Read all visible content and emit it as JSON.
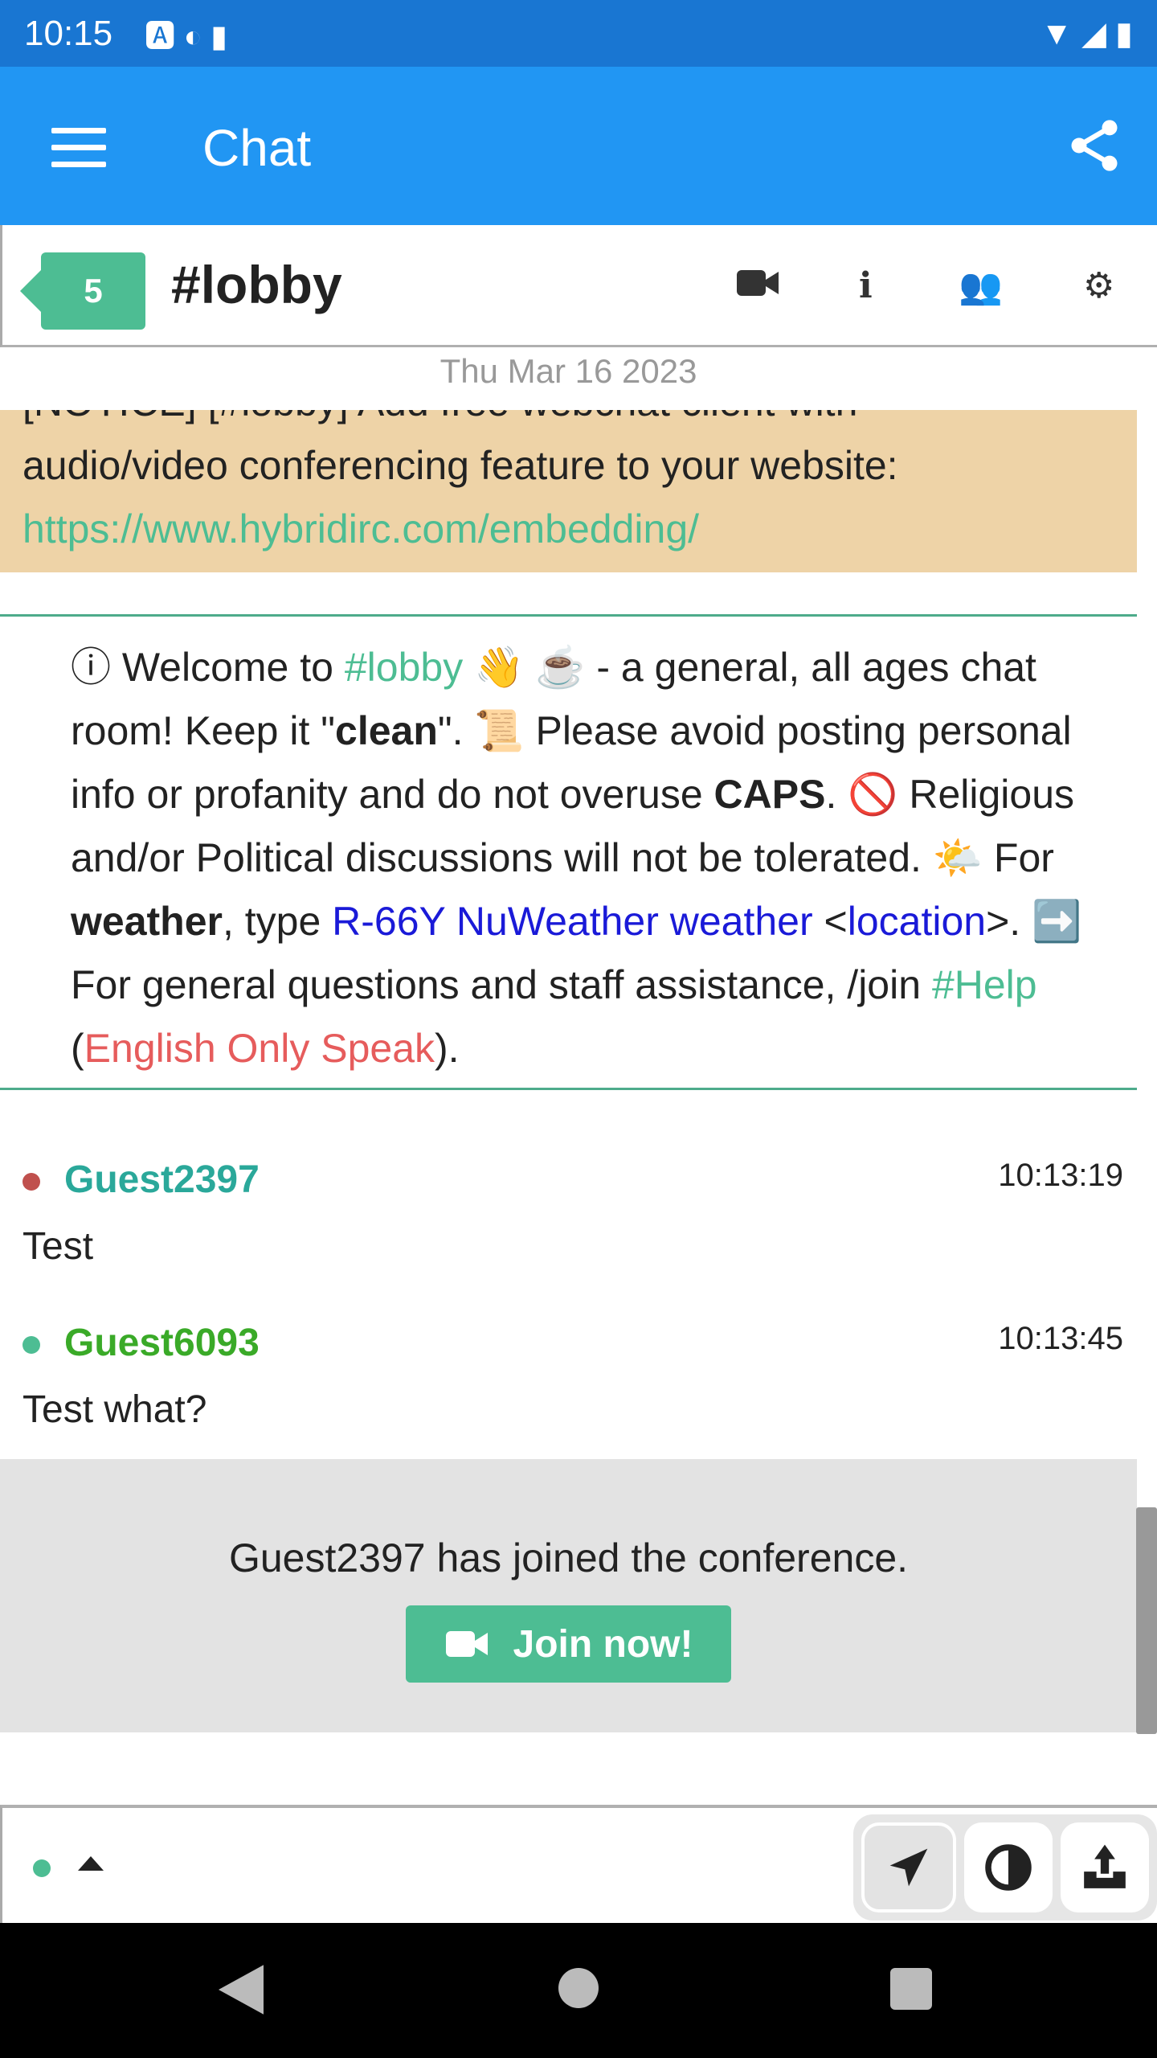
{
  "status_bar": {
    "time": "10:15"
  },
  "app_bar": {
    "title": "Chat"
  },
  "channel": {
    "unread_count": "5",
    "name": "#lobby"
  },
  "date_separator": "Thu Mar 16 2023",
  "notice": {
    "partial_line": "[NOTICE] [#lobby] Add free webchat client with",
    "text": "audio/video conferencing feature to your website:",
    "link": "https://www.hybridirc.com/embedding/"
  },
  "welcome": {
    "p1": "ⓘ Welcome to ",
    "channel": "#lobby",
    "p2": " 👋 ☕ - a general, all ages chat room! Keep it \"",
    "clean": "clean",
    "p3": "\". 📜 Please avoid posting personal info or profanity and do not overuse ",
    "caps": "CAPS",
    "p4": ". 🚫 Religious and/or Political discussions will not be tolerated. 🌤️ For ",
    "weather": "weather",
    "p5": ", type ",
    "cmd": "R-66Y NuWeather weather",
    "lt": " <",
    "location": "location",
    "p6": ">. ➡️ For general questions and staff assistance, /join ",
    "help": "#Help",
    "p7": " (",
    "english": "English Only Speak",
    "p8": ")."
  },
  "messages": [
    {
      "nick": "Guest2397",
      "time": "10:13:19",
      "text": "Test",
      "nick_color": "#2aa89a",
      "dot_color": "#c0504d"
    },
    {
      "nick": "Guest6093",
      "time": "10:13:45",
      "text": "Test what?",
      "nick_color": "#3aaa28",
      "dot_color": "#4dbd93"
    }
  ],
  "conference": {
    "text": "Guest2397 has joined the conference.",
    "button": "Join now!"
  },
  "colors": {
    "accent": "#4dbd93",
    "app_bar": "#2196f3",
    "status_bar": "#1976d2",
    "notice_bg": "#eed3a7"
  }
}
